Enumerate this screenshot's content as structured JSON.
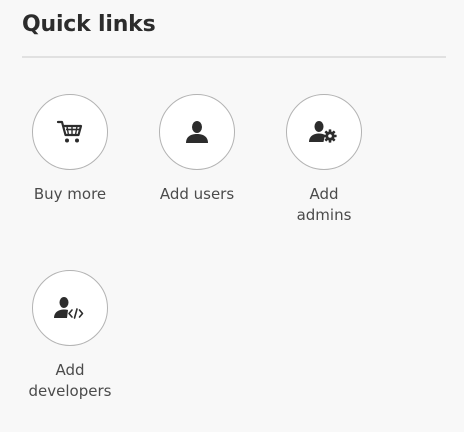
{
  "title": "Quick links",
  "links": [
    {
      "label": "Buy more",
      "icon": "cart-icon"
    },
    {
      "label": "Add users",
      "icon": "user-icon"
    },
    {
      "label": "Add\nadmins",
      "icon": "admin-gear-icon"
    },
    {
      "label": "Add\ndevelopers",
      "icon": "developer-code-icon"
    }
  ]
}
